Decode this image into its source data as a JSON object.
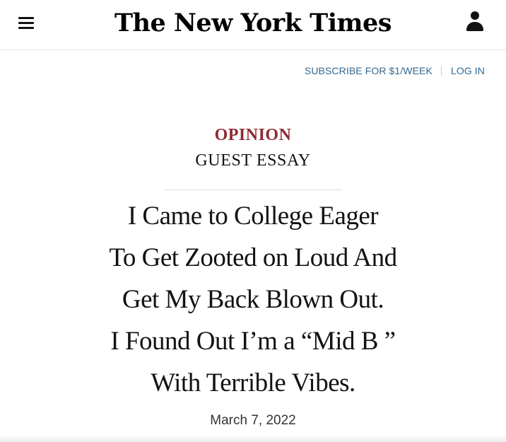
{
  "header": {
    "logo": "The New York Times",
    "menu_icon": "hamburger-menu-icon",
    "account_icon": "user-account-icon"
  },
  "subnav": {
    "subscribe": "SUBSCRIBE FOR $1/WEEK",
    "login": "LOG IN"
  },
  "article": {
    "section": "OPINION",
    "type": "GUEST ESSAY",
    "headline_lines": [
      "I Came to College Eager",
      "To Get Zooted on Loud And",
      "Get My Back Blown Out.",
      "I Found Out I’m a “Mid B   ”",
      "With Terrible Vibes."
    ],
    "date": "March 7, 2022"
  },
  "colors": {
    "section": "#8e2a33",
    "link": "#326891",
    "text": "#121212"
  }
}
